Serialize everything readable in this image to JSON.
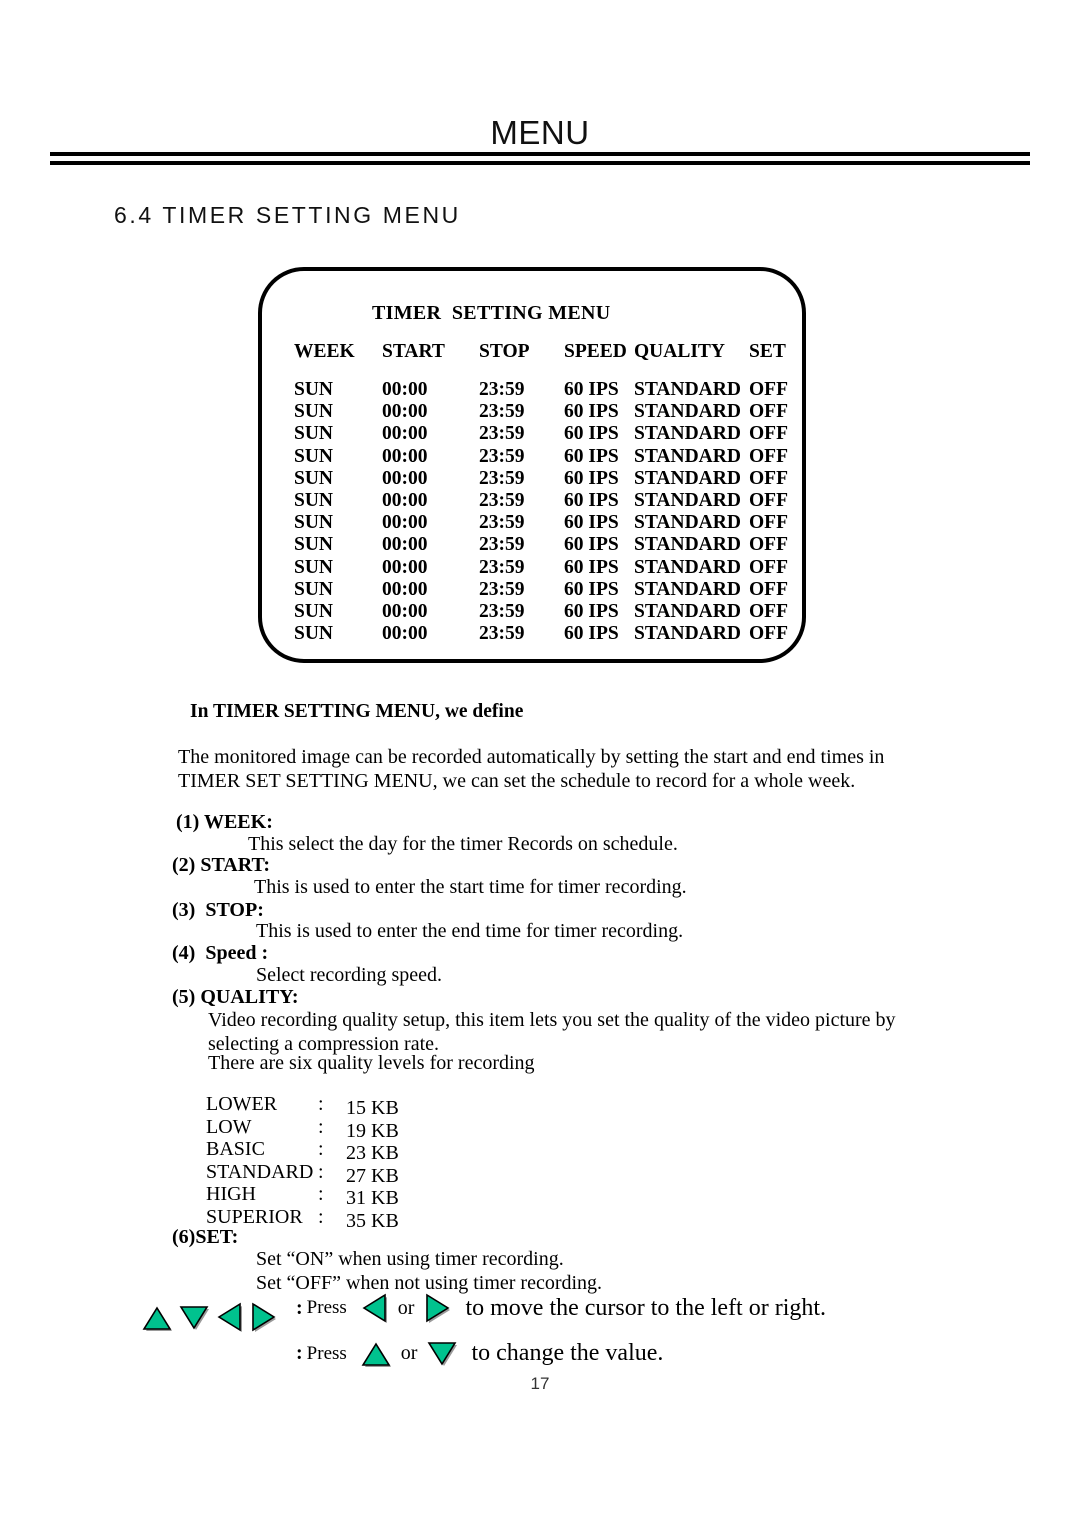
{
  "page": {
    "header_title": "MENU",
    "section_heading": "6.4 TIMER SETTING MENU",
    "page_number": "17"
  },
  "osd": {
    "title": "TIMER  SETTING MENU",
    "columns": [
      "WEEK",
      "START",
      "STOP",
      "SPEED",
      "QUALITY",
      "SET"
    ],
    "rows": [
      [
        "SUN",
        "00:00",
        "23:59",
        "60 IPS",
        "STANDARD",
        "OFF"
      ],
      [
        "SUN",
        "00:00",
        "23:59",
        "60 IPS",
        "STANDARD",
        "OFF"
      ],
      [
        "SUN",
        "00:00",
        "23:59",
        "60 IPS",
        "STANDARD",
        "OFF"
      ],
      [
        "SUN",
        "00:00",
        "23:59",
        "60 IPS",
        "STANDARD",
        "OFF"
      ],
      [
        "SUN",
        "00:00",
        "23:59",
        "60 IPS",
        "STANDARD",
        "OFF"
      ],
      [
        "SUN",
        "00:00",
        "23:59",
        "60 IPS",
        "STANDARD",
        "OFF"
      ],
      [
        "SUN",
        "00:00",
        "23:59",
        "60 IPS",
        "STANDARD",
        "OFF"
      ],
      [
        "SUN",
        "00:00",
        "23:59",
        "60 IPS",
        "STANDARD",
        "OFF"
      ],
      [
        "SUN",
        "00:00",
        "23:59",
        "60 IPS",
        "STANDARD",
        "OFF"
      ],
      [
        "SUN",
        "00:00",
        "23:59",
        "60 IPS",
        "STANDARD",
        "OFF"
      ],
      [
        "SUN",
        "00:00",
        "23:59",
        "60 IPS",
        "STANDARD",
        "OFF"
      ],
      [
        "SUN",
        "00:00",
        "23:59",
        "60 IPS",
        "STANDARD",
        "OFF"
      ]
    ]
  },
  "content": {
    "define_line": "In TIMER SETTING MENU, we define",
    "intro": "The monitored image can be recorded automatically by setting the start and end times in TIMER SET SETTING MENU, we can set the schedule to record for a whole week.",
    "items": [
      {
        "label": "(1) WEEK:",
        "body": "This select the day for the timer Records on schedule."
      },
      {
        "label": "(2) START:",
        "body": "This is used to enter the start time for timer recording."
      },
      {
        "label": "(3)  STOP:",
        "body": "This is used to enter the end time for timer recording."
      },
      {
        "label": "(4)  Speed :",
        "body": "Select  recording speed."
      },
      {
        "label": "(5) QUALITY:",
        "body": "Video recording quality setup, this item lets you set the quality of the video picture by selecting a compression rate.",
        "body2": "There are six quality levels for recording"
      },
      {
        "label": "(6)SET:",
        "body_line1": "Set  “ON” when using timer recording.",
        "body_line2": "Set  “OFF” when not using timer recording."
      }
    ],
    "quality_levels": [
      {
        "name": "LOWER",
        "colon": ":",
        "value": "15 KB"
      },
      {
        "name": "LOW",
        "colon": ":",
        "value": "19 KB"
      },
      {
        "name": "BASIC",
        "colon": ":",
        "value": "23 KB"
      },
      {
        "name": "STANDARD",
        "colon": ":",
        "value": "27 KB"
      },
      {
        "name": "HIGH",
        "colon": ":",
        "value": "31 KB"
      },
      {
        "name": "SUPERIOR",
        "colon": ":",
        "value": "35 KB"
      }
    ]
  },
  "legend": {
    "cluster_icons": [
      "arrow-up-icon",
      "arrow-down-icon",
      "arrow-left-icon",
      "arrow-right-icon"
    ],
    "line1": {
      "colon": ":",
      "press": "Press",
      "icon_a": "arrow-left-icon",
      "or": "or",
      "icon_b": "arrow-right-icon",
      "tail": "to move the cursor to the left or right."
    },
    "line2": {
      "colon": ":",
      "press": "Press",
      "icon_a": "arrow-up-icon",
      "or": "or",
      "icon_b": "arrow-down-icon",
      "tail": "to change the value."
    }
  },
  "colors": {
    "arrow_fill": "#00c28e",
    "arrow_stroke": "#000000",
    "arrow_shadow": "#9a9a9a",
    "rule": "#000000"
  }
}
